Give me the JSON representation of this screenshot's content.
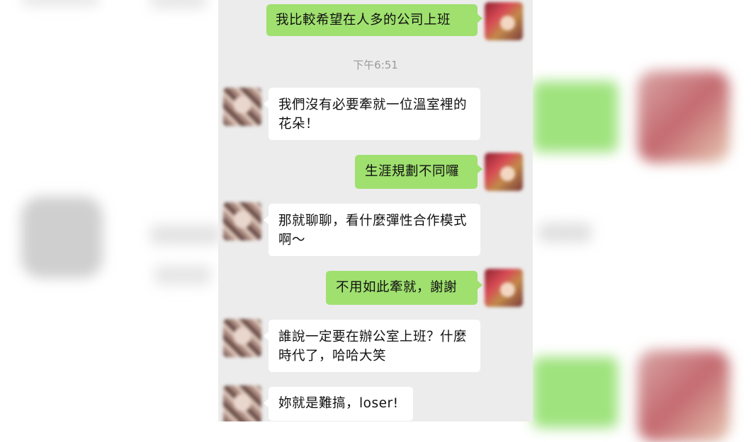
{
  "timestamp": "下午6:51",
  "messages": [
    {
      "from": "self",
      "text": "我比較希望在人多的公司上班"
    },
    {
      "from": "other",
      "text": "我們沒有必要牽就一位溫室裡的花朵！"
    },
    {
      "from": "self",
      "text": "生涯規劃不同囉"
    },
    {
      "from": "other",
      "text": "那就聊聊，看什麼彈性合作模式啊～"
    },
    {
      "from": "self",
      "text": "不用如此牽就，謝謝"
    },
    {
      "from": "other",
      "text": "誰說一定要在辦公室上班？什麼時代了，哈哈大笑"
    },
    {
      "from": "other",
      "text": "妳就是難搞，loser!"
    }
  ],
  "colors": {
    "self_bubble": "#9fe06f",
    "other_bubble": "#ffffff",
    "chat_bg": "#ececec"
  }
}
